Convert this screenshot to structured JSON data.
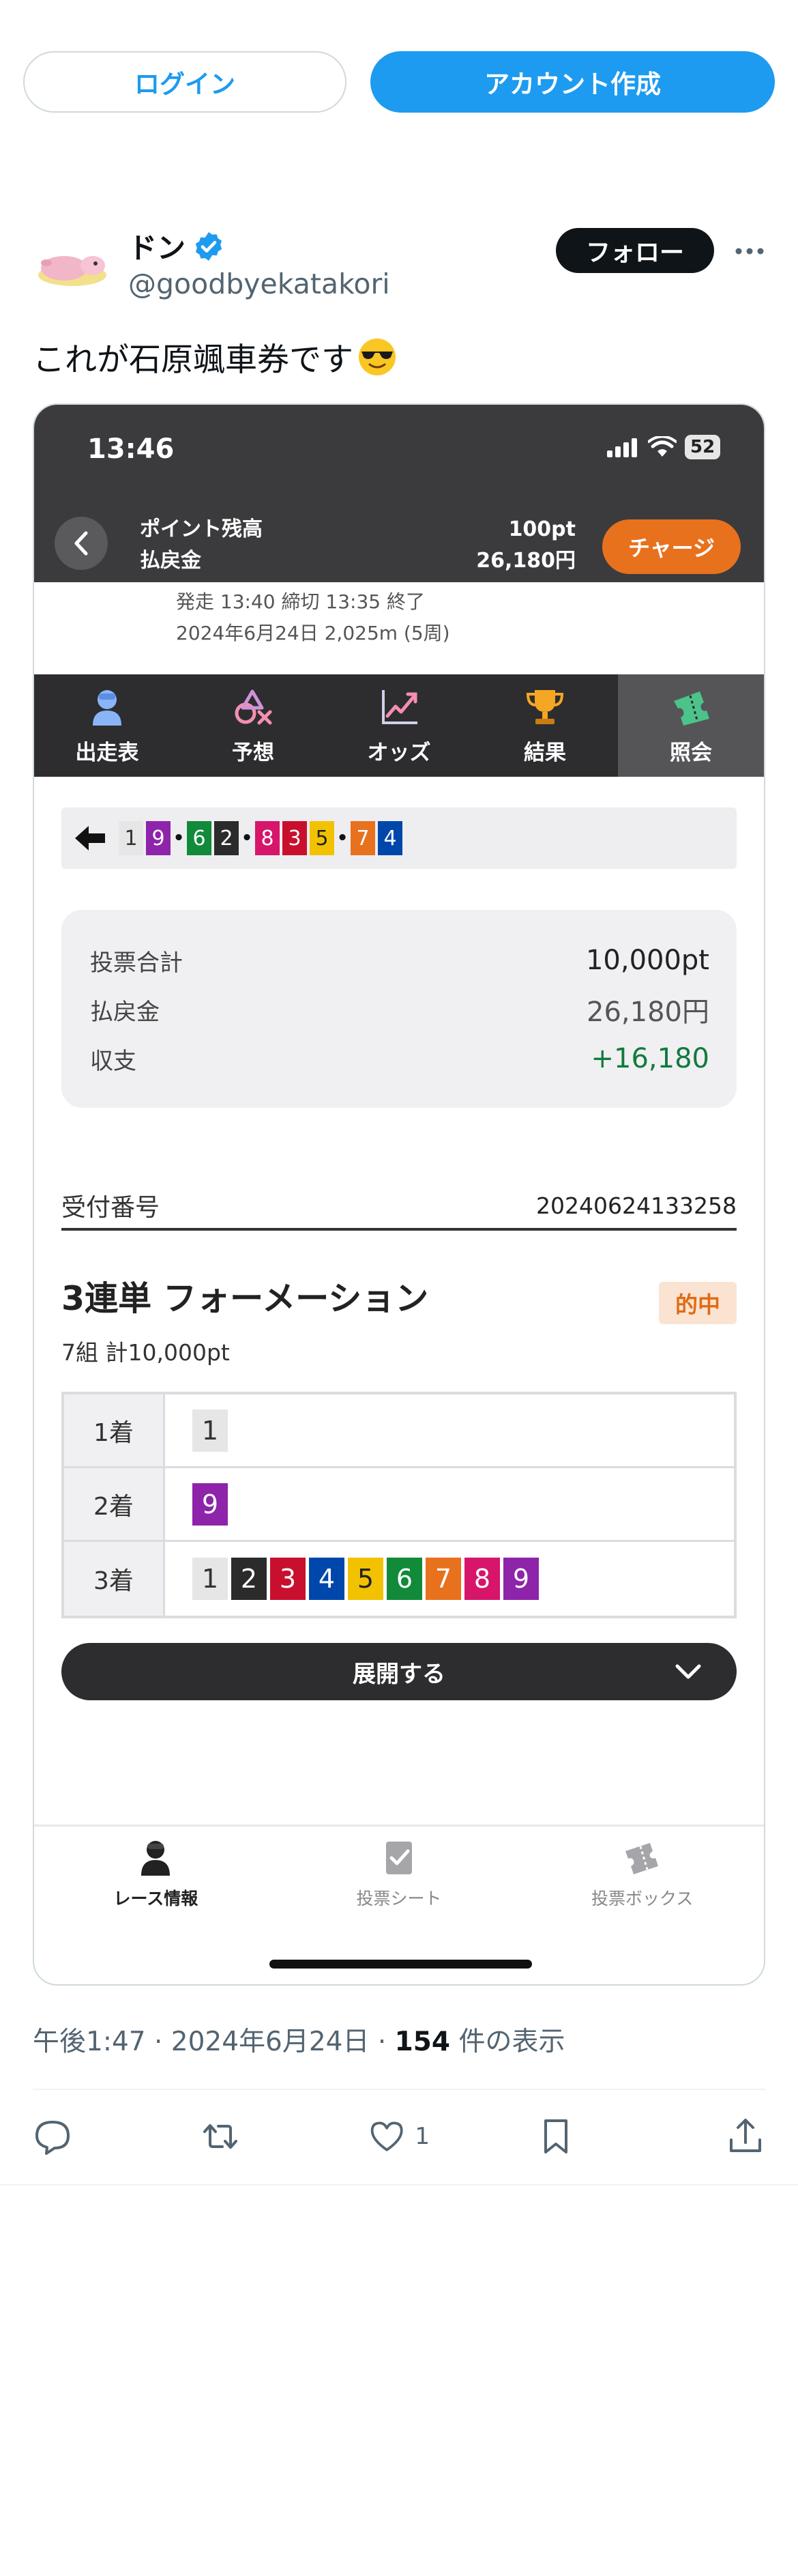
{
  "top": {
    "login_label": "ログイン",
    "create_account_label": "アカウント作成"
  },
  "tweet": {
    "author_name": "ドン",
    "author_handle": "@goodbyekatakori",
    "follow_label": "フォロー",
    "text": "これが石原颯車券です",
    "timestamp": "午後1:47 · 2024年6月24日 · ",
    "views_count": "154",
    "views_label": " 件の表示",
    "like_count": "1"
  },
  "phone": {
    "time": "13:46",
    "battery": "52",
    "point_label": "ポイント残高",
    "payout_label": "払戻金",
    "point_value": "100pt",
    "payout_value": "26,180円",
    "charge_label": "チャージ",
    "race_line1": "発走 13:40 締切 13:35 終了",
    "race_line2": "2024年6月24日 2,025m (5周)",
    "tabs": [
      {
        "label": "出走表",
        "icon": "rider-icon"
      },
      {
        "label": "予想",
        "icon": "prediction-icon"
      },
      {
        "label": "オッズ",
        "icon": "odds-chart-icon"
      },
      {
        "label": "結果",
        "icon": "trophy-icon"
      },
      {
        "label": "照会",
        "icon": "ticket-icon"
      }
    ],
    "selection": [
      "1",
      "9",
      "•",
      "6",
      "2",
      "•",
      "8",
      "3",
      "5",
      "•",
      "7",
      "4"
    ],
    "summary": {
      "total_label": "投票合計",
      "total_value": "10,000pt",
      "payout_label": "払戻金",
      "payout_value": "26,180円",
      "balance_label": "収支",
      "balance_value": "+16,180"
    },
    "receipt_label": "受付番号",
    "receipt_number": "20240624133258",
    "bet_title": "3連単 フォーメーション",
    "hit_label": "的中",
    "bet_sub": "7組 計10,000pt",
    "formation": [
      {
        "label": "1着",
        "nums": [
          "1"
        ]
      },
      {
        "label": "2着",
        "nums": [
          "9"
        ]
      },
      {
        "label": "3着",
        "nums": [
          "1",
          "2",
          "3",
          "4",
          "5",
          "6",
          "7",
          "8",
          "9"
        ]
      }
    ],
    "expand_label": "展開する",
    "bottom_nav": [
      {
        "label": "レース情報",
        "icon": "rider-icon"
      },
      {
        "label": "投票シート",
        "icon": "checklist-icon"
      },
      {
        "label": "投票ボックス",
        "icon": "tickets-icon"
      }
    ],
    "bike_colors": {
      "1": "#e6e6e6",
      "2": "#2b2b2b",
      "3": "#c8102e",
      "4": "#0047ab",
      "5": "#f2c200",
      "6": "#118a3a",
      "7": "#e8711e",
      "8": "#d6156b",
      "9": "#8e24aa"
    }
  }
}
